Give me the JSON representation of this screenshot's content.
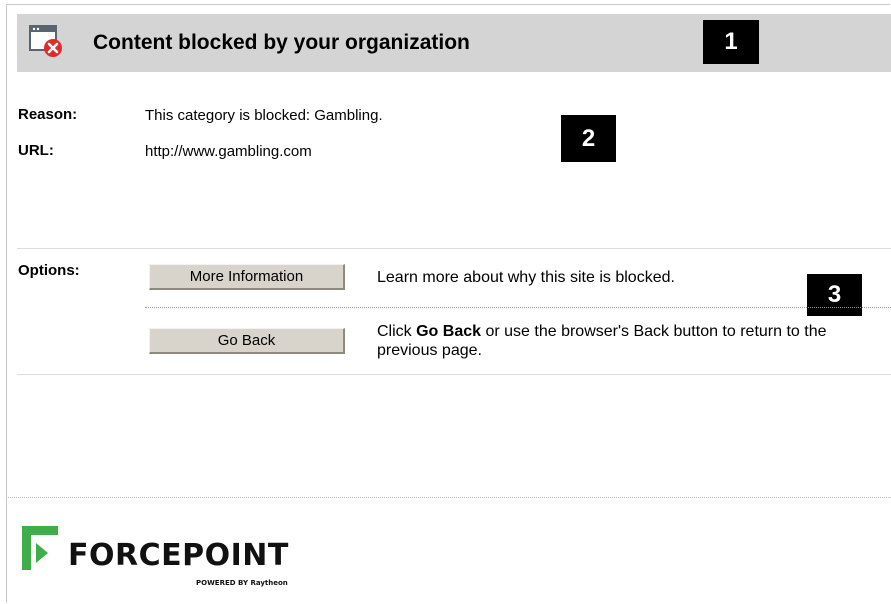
{
  "header": {
    "title": "Content blocked by your organization",
    "icon": "blocked-window-icon"
  },
  "markers": [
    "1",
    "2",
    "3"
  ],
  "details": {
    "reason_label": "Reason:",
    "reason_value": "This category is blocked: Gambling.",
    "url_label": "URL:",
    "url_value": "http://www.gambling.com"
  },
  "options": {
    "label": "Options:",
    "items": [
      {
        "button": "More Information",
        "description": "Learn more about why this site is blocked."
      },
      {
        "button": "Go Back",
        "description_prefix": "Click ",
        "description_bold": "Go Back",
        "description_suffix": " or use the browser's Back button to return to the previous page."
      }
    ]
  },
  "footer": {
    "logo_text": "FORCEPOINT",
    "logo_sub": "POWERED BY Raytheon",
    "brand_color": "#3fae49"
  }
}
